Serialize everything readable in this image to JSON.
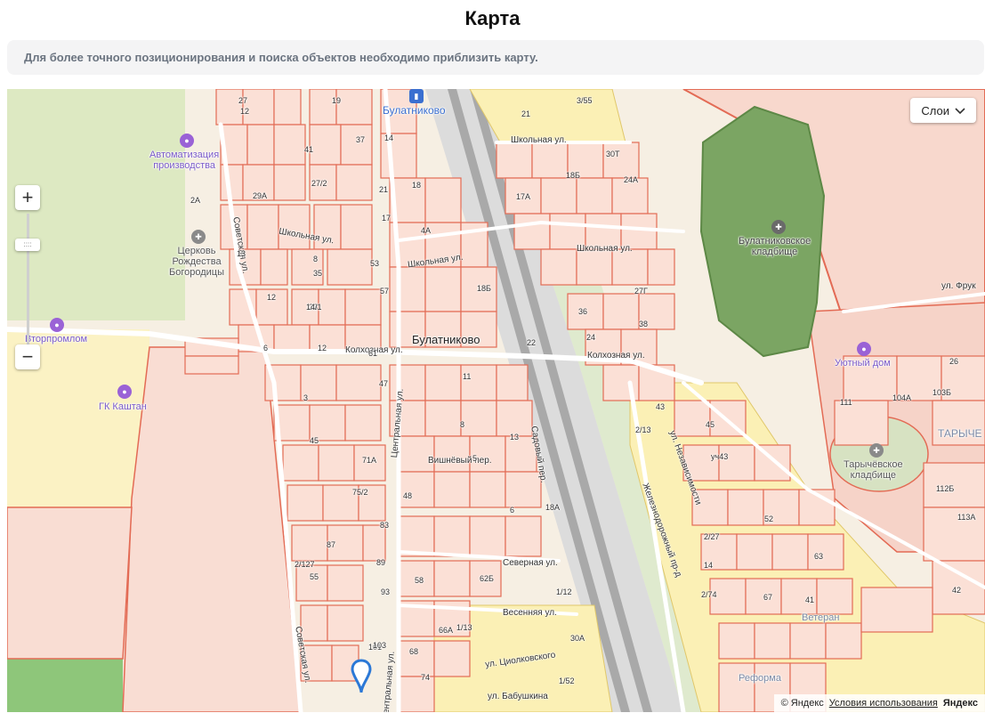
{
  "page": {
    "title": "Карта",
    "notice": "Для более точного позиционирования и поиска объектов необходимо приблизить карту."
  },
  "map": {
    "controls": {
      "zoom_in": "+",
      "zoom_out": "−",
      "zoom_handle": "::::",
      "layers_label": "Слои"
    },
    "attribution": {
      "copyright": "© Яндекс",
      "terms": "Условия использования",
      "brand": "Яндекс"
    },
    "places": {
      "village": "Булатниково",
      "station": "Булатниково",
      "district_taryev": "ТАРЫЧЕ",
      "veteran": "Ветеран",
      "reforma": "Реформа"
    },
    "pois": {
      "automation": "Автоматизация\nпроизводства",
      "church": "Церковь\nРождества\nБогородицы",
      "vtorpromlom": "Вторпромлом",
      "kashtan": "ГК Каштан",
      "cemetery_bulat": "Булатниковское\nкладбище",
      "uyutny": "Уютный дом",
      "cemetery_tar": "Тарычёвское\nкладбище"
    },
    "streets": {
      "shkolnaya_1": "Школьная ул.",
      "shkolnaya_2": "Школьная ул.",
      "shkolnaya_3": "Школьная ул.",
      "shkolnaya_4": "Школьная ул.",
      "kolkhoznaya_1": "Колхозная ул.",
      "kolkhoznaya_2": "Колхозная ул.",
      "sovetskaya_1": "Советская ул.",
      "sovetskaya_2": "Советская ул.",
      "tsentralnaya_1": "Центральная ул.",
      "tsentralnaya_2": "Центральная ул.",
      "vishnevy": "Вишнёвый пер.",
      "sadovy": "Садовый пер.",
      "severnaya": "Северная ул.",
      "vesennyaya": "Весенняя ул.",
      "tsiolkovskogo": "ул. Циолковского",
      "babushkina": "ул. Бабушкина",
      "nezavisimosti": "ул. Независимости",
      "railway": "Железнодорожный пр-д",
      "fruktovaya": "ул. Фрук"
    },
    "house_numbers": [
      "27",
      "12",
      "19",
      "37",
      "14",
      "41",
      "27/2",
      "29А",
      "21",
      "17",
      "13",
      "8",
      "12",
      "33",
      "6",
      "12",
      "14/1",
      "47",
      "35",
      "53",
      "57",
      "61",
      "3/55",
      "21",
      "30Т",
      "24А",
      "17А",
      "18Б",
      "4А",
      "2А",
      "18Б",
      "27Г",
      "36",
      "38",
      "24",
      "22",
      "18",
      "3",
      "45",
      "71А",
      "75/2",
      "48",
      "83",
      "87",
      "2/127",
      "55",
      "89",
      "93",
      "58",
      "62Б",
      "101",
      "103",
      "68",
      "74",
      "66А",
      "1/12",
      "1/13",
      "30А",
      "1/52",
      "2/13",
      "43",
      "45",
      "уч43",
      "2/27",
      "14",
      "2/74",
      "52",
      "63",
      "67",
      "41",
      "104А",
      "103Б",
      "26",
      "111",
      "112Б",
      "113А",
      "42",
      "8",
      "6",
      "13",
      "11",
      "18А",
      "5"
    ]
  }
}
